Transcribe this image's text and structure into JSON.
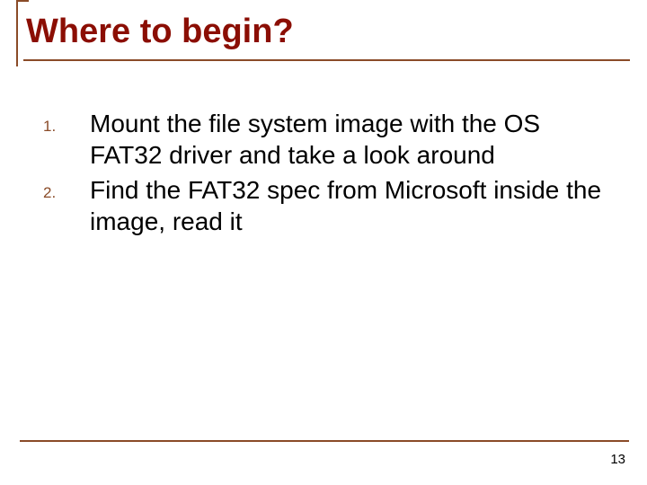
{
  "title": "Where to begin?",
  "items": [
    "Mount the file system image with the OS FAT32 driver and take a look around",
    "Find the FAT32 spec from Microsoft inside the image, read it"
  ],
  "page_number": "13"
}
